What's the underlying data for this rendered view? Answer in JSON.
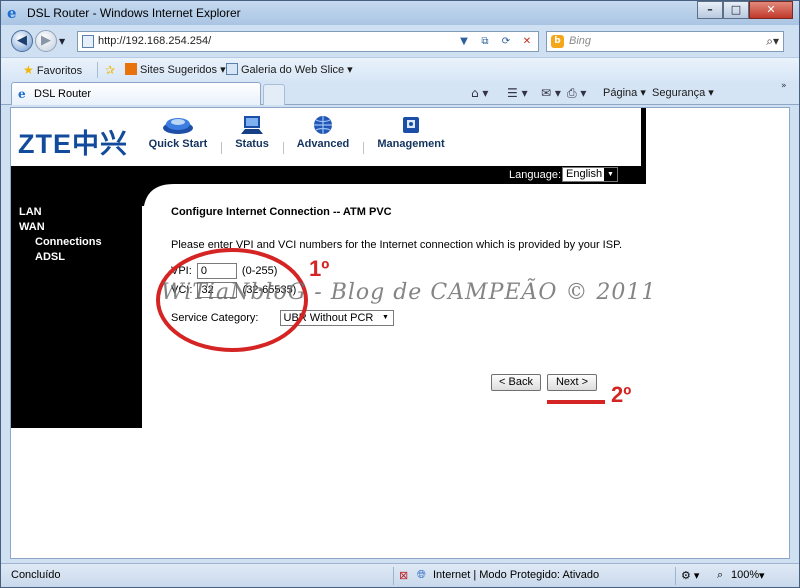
{
  "browser": {
    "title": "DSL Router - Windows Internet Explorer",
    "url": "http://192.168.254.254/",
    "search_placeholder": "Bing",
    "favorites_label": "Favoritos",
    "fav_items": [
      "Sites Sugeridos",
      "Galeria do Web Slice"
    ],
    "tab_title": "DSL Router",
    "cmd_items": [
      "Página",
      "Segurança"
    ],
    "status_left": "Concluído",
    "status_zone": "Internet | Modo Protegido: Ativado",
    "zoom": "100%"
  },
  "router": {
    "logo": "ZTE中兴",
    "nav": [
      "Quick Start",
      "Status",
      "Advanced",
      "Management"
    ],
    "language_label": "Language:",
    "language_value": "English",
    "menu": [
      "LAN",
      "WAN",
      "Connections",
      "ADSL"
    ],
    "page_title": "Configure Internet Connection -- ATM PVC",
    "description": "Please enter VPI and VCI numbers for the Internet connection which is provided by your ISP.",
    "vpi_label": "VPI:",
    "vpi_value": "0",
    "vpi_range": "(0-255)",
    "vci_label": "VCI:",
    "vci_value": "32",
    "vci_range": "(32-65535)",
    "service_label": "Service Category:",
    "service_value": "UBR Without PCR",
    "back_label": "< Back",
    "next_label": "Next >"
  },
  "annotations": {
    "watermark": "WiTiaNbloG - Blog de CAMPEÃO © 2011",
    "step1": "1º",
    "step2": "2º",
    "annotation_color": "#d42424"
  }
}
